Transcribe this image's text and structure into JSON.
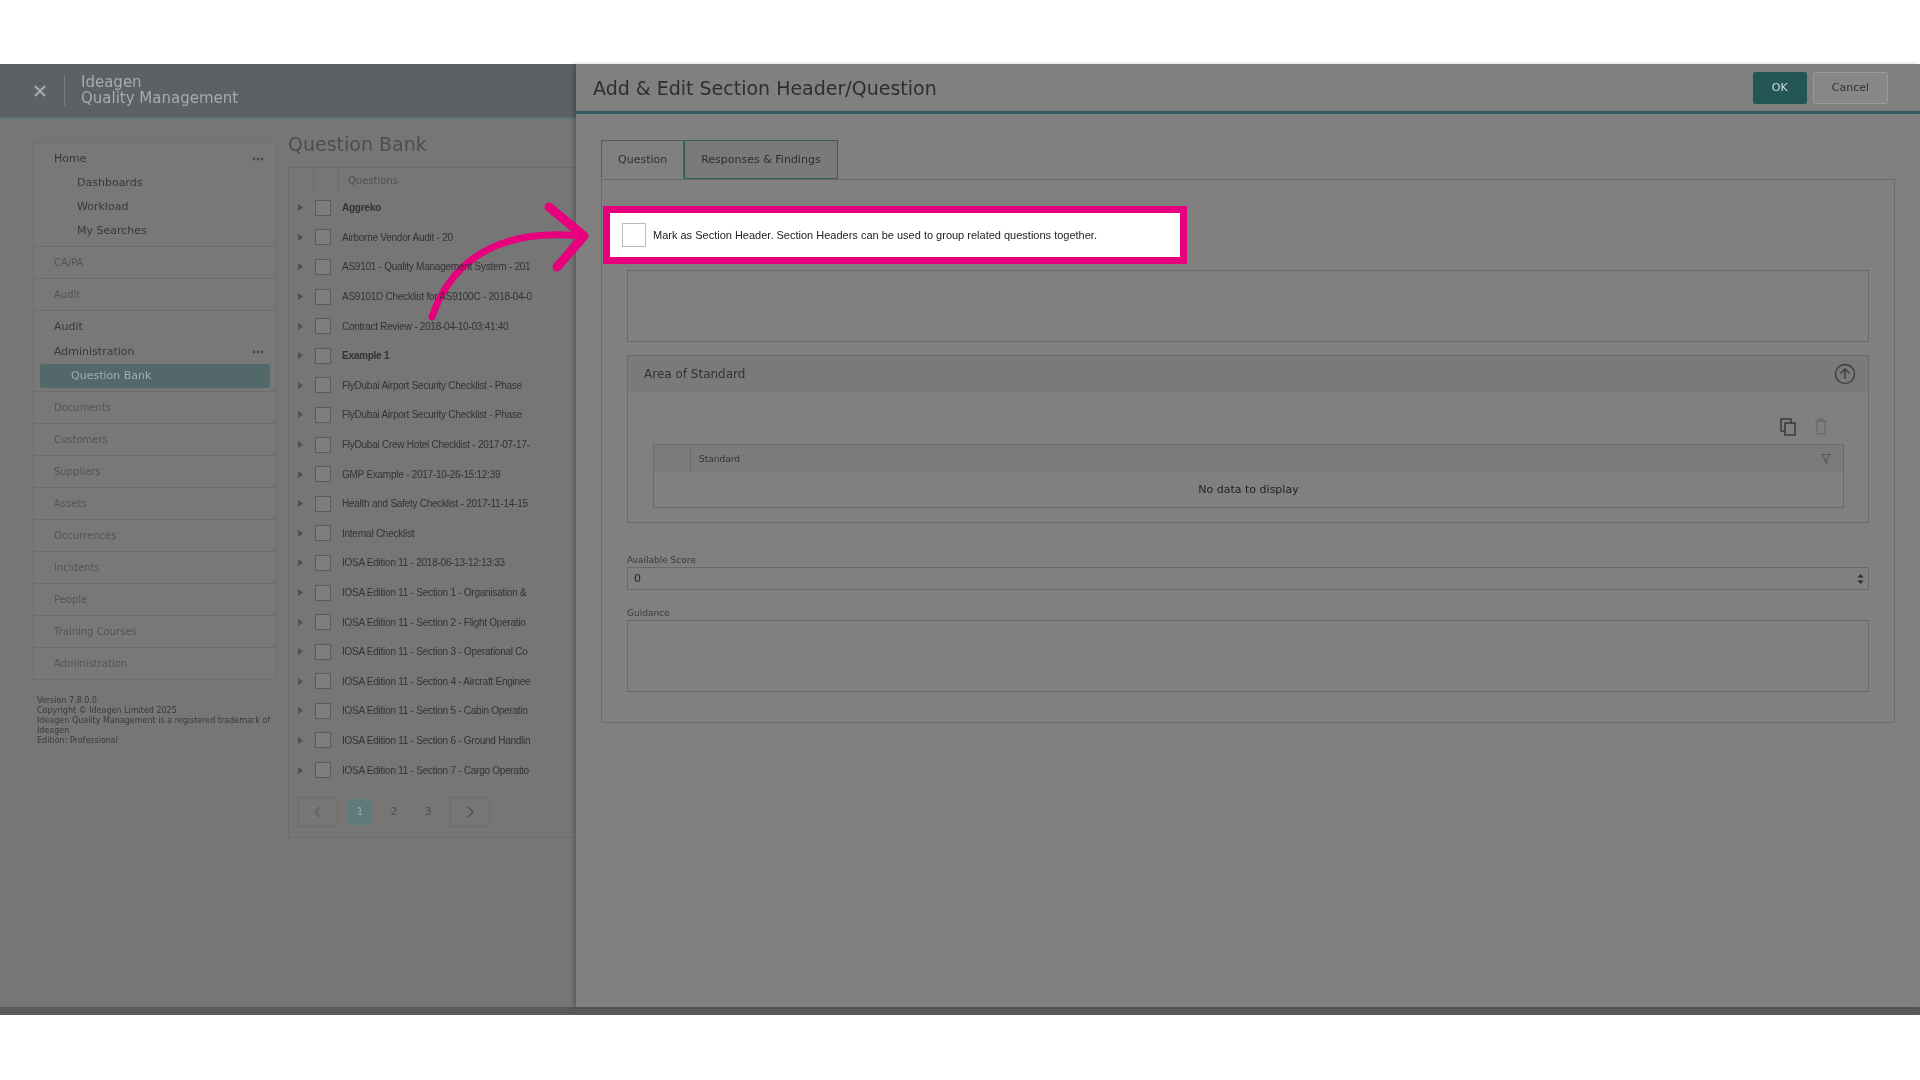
{
  "app": {
    "brand": "Ideagen",
    "product": "Quality Management"
  },
  "sidebar": {
    "sections": [
      {
        "items": [
          {
            "label": "Home",
            "disabled": false,
            "menu": true,
            "children": [
              {
                "label": "Dashboards",
                "selected": false
              },
              {
                "label": "Workload",
                "selected": false
              },
              {
                "label": "My Searches",
                "selected": false
              }
            ]
          }
        ]
      },
      {
        "items": [
          {
            "label": "CA/PA",
            "disabled": true,
            "menu": false
          }
        ]
      },
      {
        "items": [
          {
            "label": "Audit",
            "disabled": true,
            "menu": false
          }
        ]
      },
      {
        "items": [
          {
            "label": "Audit",
            "disabled": false,
            "menu": false
          },
          {
            "label": "Administration",
            "disabled": false,
            "menu": true,
            "children": [
              {
                "label": "Question Bank",
                "selected": true
              }
            ]
          }
        ]
      },
      {
        "items": [
          {
            "label": "Documents",
            "disabled": true,
            "menu": false
          }
        ]
      },
      {
        "items": [
          {
            "label": "Customers",
            "disabled": true,
            "menu": false
          }
        ]
      },
      {
        "items": [
          {
            "label": "Suppliers",
            "disabled": true,
            "menu": false
          }
        ]
      },
      {
        "items": [
          {
            "label": "Assets",
            "disabled": true,
            "menu": false
          }
        ]
      },
      {
        "items": [
          {
            "label": "Occurrences",
            "disabled": true,
            "menu": false
          }
        ]
      },
      {
        "items": [
          {
            "label": "Incidents",
            "disabled": true,
            "menu": false
          }
        ]
      },
      {
        "items": [
          {
            "label": "People",
            "disabled": true,
            "menu": false
          }
        ]
      },
      {
        "items": [
          {
            "label": "Training Courses",
            "disabled": true,
            "menu": false
          }
        ]
      },
      {
        "items": [
          {
            "label": "Administration",
            "disabled": true,
            "menu": false
          }
        ]
      }
    ],
    "footer": [
      "Version 7.8.0.0",
      "Copyright © Ideagen Limited 2025",
      "Ideagen Quality Management is a registered trademark of Ideagen",
      "Edition: Professional"
    ]
  },
  "question_bank": {
    "title": "Question Bank",
    "column": "Questions",
    "rows": [
      {
        "text": "Aggreko",
        "bold": true,
        "checked": false
      },
      {
        "text": "Airborne Vendor Audit - 20",
        "bold": false,
        "checked": false
      },
      {
        "text": "AS9101 - Quality Management System - 201",
        "bold": false,
        "checked": false
      },
      {
        "text": "AS9101D Checklist for AS9100C - 2018-04-0",
        "bold": false,
        "checked": false
      },
      {
        "text": "Contract Review - 2018-04-10-03:41:40",
        "bold": false,
        "checked": false
      },
      {
        "text": "Example 1",
        "bold": true,
        "checked": false
      },
      {
        "text": "FlyDubai Airport Security Checklist - Phase",
        "bold": false,
        "checked": false
      },
      {
        "text": "FlyDubai Airport Security Checklist - Phase",
        "bold": false,
        "checked": false
      },
      {
        "text": "FlyDubai Crew Hotel Checklist - 2017-07-17-",
        "bold": false,
        "checked": false
      },
      {
        "text": "GMP Example - 2017-10-26-15:12:39",
        "bold": false,
        "checked": false
      },
      {
        "text": "Health and Safety Checklist - 2017-11-14-15",
        "bold": false,
        "checked": false
      },
      {
        "text": "Internal Checklist",
        "bold": false,
        "checked": false
      },
      {
        "text": "IOSA Edition 11 - 2018-06-13-12:13:33",
        "bold": false,
        "checked": false
      },
      {
        "text": "IOSA Edition 11 - Section 1 - Organisation &",
        "bold": false,
        "checked": false
      },
      {
        "text": "IOSA Edition 11 - Section 2 - Flight Operatio",
        "bold": false,
        "checked": false
      },
      {
        "text": "IOSA Edition 11 - Section 3 - Operational Co",
        "bold": false,
        "checked": false
      },
      {
        "text": "IOSA Edition 11 - Section 4 - Aircraft Enginee",
        "bold": false,
        "checked": false
      },
      {
        "text": "IOSA Edition 11 - Section 5 - Cabin Operatio",
        "bold": false,
        "checked": false
      },
      {
        "text": "IOSA Edition 11 - Section 6 - Ground Handlin",
        "bold": false,
        "checked": false
      },
      {
        "text": "IOSA Edition 11 - Section 7 - Cargo Operatio",
        "bold": false,
        "checked": false
      }
    ],
    "pages": [
      {
        "label": "1",
        "selected": true
      },
      {
        "label": "2",
        "selected": false
      },
      {
        "label": "3",
        "selected": false
      }
    ]
  },
  "dialog": {
    "title": "Add & Edit Section Header/Question",
    "buttons": [
      {
        "label": "OK",
        "kind": "primary"
      },
      {
        "label": "Cancel",
        "kind": "secondary"
      }
    ],
    "tabs": [
      {
        "label": "Question",
        "selected": true
      },
      {
        "label": "Responses & Findings",
        "selected": false
      }
    ],
    "section_header": {
      "checked": false,
      "label": "Mark as Section Header. Section Headers can be used to group related questions together."
    },
    "area_of_standard": {
      "title": "Area of Standard",
      "column": "Standard",
      "empty_text": "No data to display"
    },
    "available_score": {
      "label": "Available Score",
      "value": "0"
    },
    "guidance": {
      "label": "Guidance"
    }
  }
}
